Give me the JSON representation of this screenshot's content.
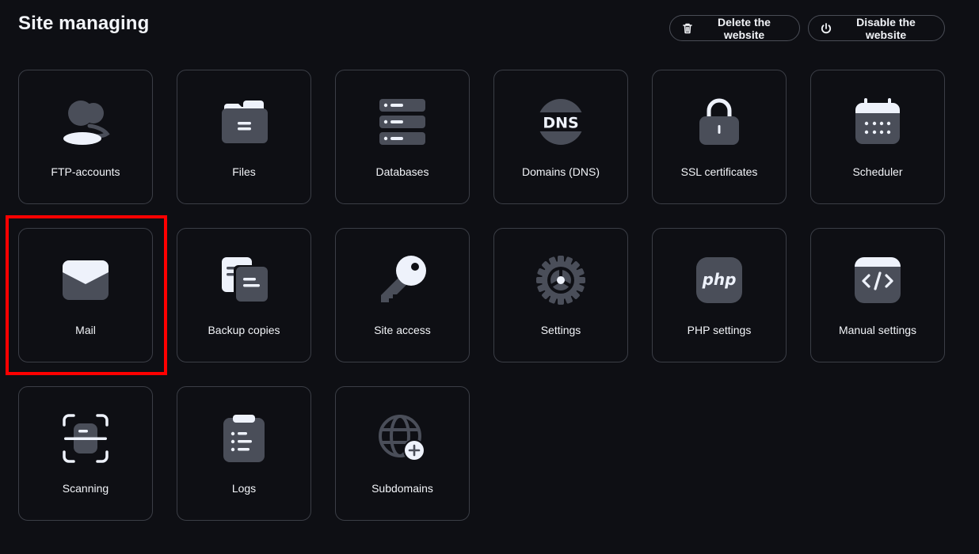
{
  "header": {
    "title": "Site managing",
    "delete_label": "Delete the website",
    "disable_label": "Disable the website"
  },
  "colors": {
    "background": "#0e0f14",
    "tile_border": "#3b3e46",
    "icon_dark": "#4a4e59",
    "icon_light": "#eef2fb",
    "highlight": "#ff0000"
  },
  "tiles": [
    {
      "label": "FTP-accounts",
      "icon": "ftp-users-icon"
    },
    {
      "label": "Files",
      "icon": "folder-icon"
    },
    {
      "label": "Databases",
      "icon": "database-icon"
    },
    {
      "label": "Domains (DNS)",
      "icon": "dns-icon",
      "icon_text": "DNS"
    },
    {
      "label": "SSL certificates",
      "icon": "lock-icon"
    },
    {
      "label": "Scheduler",
      "icon": "calendar-icon"
    },
    {
      "label": "Mail",
      "icon": "envelope-icon",
      "highlighted": true
    },
    {
      "label": "Backup copies",
      "icon": "copy-icon"
    },
    {
      "label": "Site access",
      "icon": "key-icon"
    },
    {
      "label": "Settings",
      "icon": "gear-icon"
    },
    {
      "label": "PHP settings",
      "icon": "php-icon",
      "icon_text": "php"
    },
    {
      "label": "Manual settings",
      "icon": "code-icon"
    },
    {
      "label": "Scanning",
      "icon": "scan-icon"
    },
    {
      "label": "Logs",
      "icon": "clipboard-list-icon"
    },
    {
      "label": "Subdomains",
      "icon": "globe-plus-icon"
    }
  ]
}
